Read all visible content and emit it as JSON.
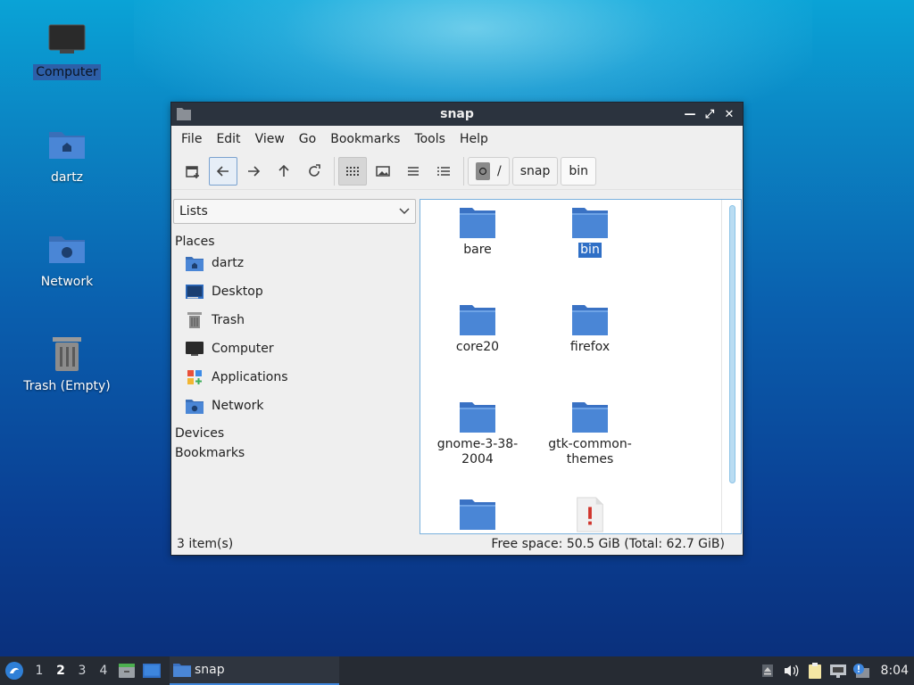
{
  "desktop": {
    "icons": [
      {
        "label": "Computer",
        "icon": "computer-icon"
      },
      {
        "label": "dartz",
        "icon": "home-folder-icon"
      },
      {
        "label": "Network",
        "icon": "network-folder-icon"
      },
      {
        "label": "Trash (Empty)",
        "icon": "trash-icon"
      }
    ]
  },
  "window": {
    "title": "snap",
    "menu": [
      "File",
      "Edit",
      "View",
      "Go",
      "Bookmarks",
      "Tools",
      "Help"
    ],
    "breadcrumb": {
      "root": "/",
      "items": [
        "snap",
        "bin"
      ]
    },
    "side": {
      "combo_value": "Lists",
      "places_header": "Places",
      "places": [
        {
          "label": "dartz",
          "icon": "home-folder-icon"
        },
        {
          "label": "Desktop",
          "icon": "desktop-icon"
        },
        {
          "label": "Trash",
          "icon": "trash-icon"
        },
        {
          "label": "Computer",
          "icon": "computer-icon"
        },
        {
          "label": "Applications",
          "icon": "applications-icon"
        },
        {
          "label": "Network",
          "icon": "network-folder-icon"
        }
      ],
      "devices_header": "Devices",
      "bookmarks_header": "Bookmarks"
    },
    "files": [
      {
        "name": "bare",
        "type": "folder"
      },
      {
        "name": "bin",
        "type": "folder",
        "selected": true
      },
      {
        "name": "core20",
        "type": "folder"
      },
      {
        "name": "firefox",
        "type": "folder"
      },
      {
        "name": "gnome-3-38-2004",
        "type": "folder"
      },
      {
        "name": "gtk-common-themes",
        "type": "folder"
      },
      {
        "name": "",
        "type": "folder"
      },
      {
        "name": "",
        "type": "unknown-file"
      }
    ],
    "status": {
      "items": "3 item(s)",
      "space": "Free space: 50.5 GiB (Total: 62.7 GiB)"
    }
  },
  "taskbar": {
    "workspaces": [
      "1",
      "2",
      "3",
      "4"
    ],
    "current_workspace": "2",
    "task_label": "snap",
    "clock": "8:04"
  },
  "colors": {
    "accent": "#3f85d9",
    "folder": "#4a86d6",
    "titlebar": "#2b333e"
  }
}
